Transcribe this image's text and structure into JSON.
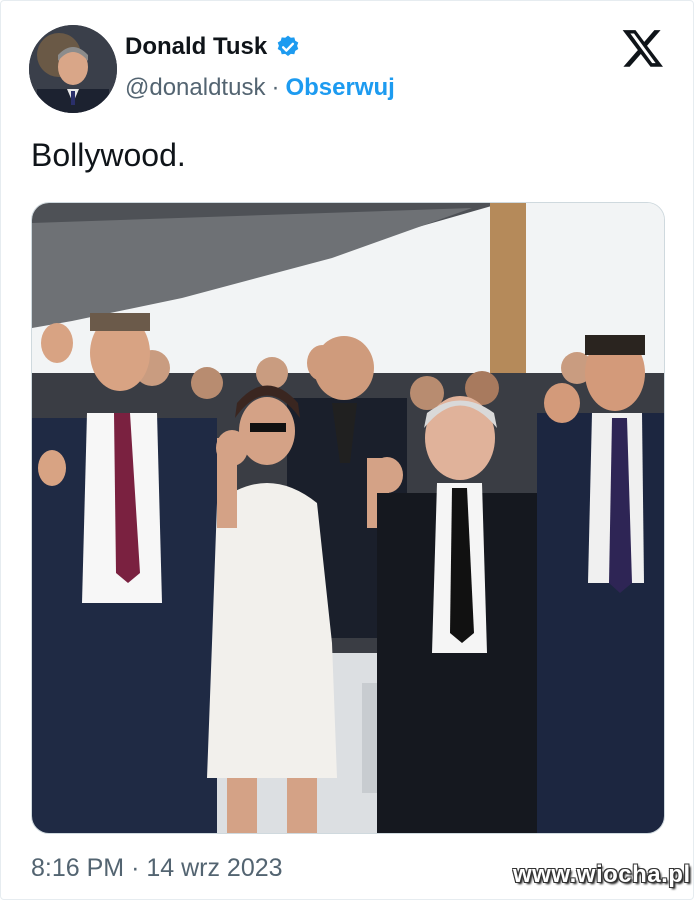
{
  "author": {
    "name": "Donald Tusk",
    "handle": "@donaldtusk",
    "separator": "·",
    "follow_label": "Obserwuj",
    "avatar_icon": "user-avatar",
    "verified_icon": "verified-badge-icon"
  },
  "platform_icon": "x-logo-icon",
  "tweet": {
    "text": "Bollywood.",
    "photo_icon": "photo-image"
  },
  "timestamp": {
    "time": "8:16 PM",
    "separator": "·",
    "date": "14 wrz 2023"
  },
  "watermark": "www.wiocha.pl",
  "colors": {
    "accent": "#1d9bf0",
    "text_primary": "#0f1419",
    "text_secondary": "#536471"
  }
}
